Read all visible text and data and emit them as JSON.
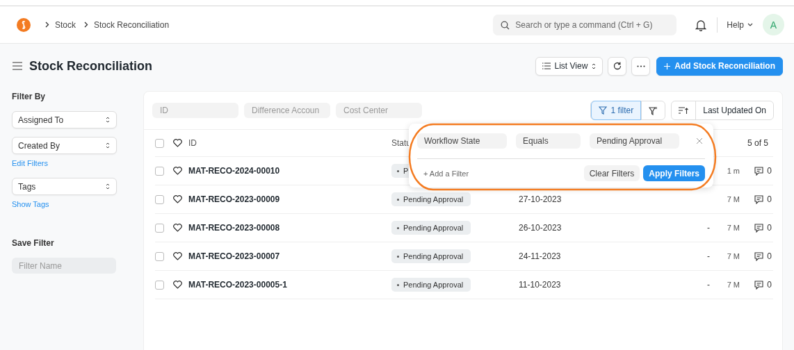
{
  "navbar": {
    "breadcrumbs": [
      "Stock",
      "Stock Reconciliation"
    ],
    "search": {
      "placeholder": "Search or type a command (Ctrl + G)"
    },
    "help": "Help",
    "avatar": "A"
  },
  "page": {
    "title": "Stock Reconciliation",
    "view_button": "List View",
    "add_button": "Add Stock Reconciliation"
  },
  "sidebar": {
    "heading": "Filter By",
    "items": [
      {
        "kind": "select",
        "label": "Assigned To"
      },
      {
        "kind": "select",
        "label": "Created By"
      },
      {
        "kind": "link",
        "label": "Edit Filters"
      },
      {
        "kind": "select",
        "label": "Tags"
      },
      {
        "kind": "link",
        "label": "Show Tags"
      }
    ],
    "save_heading": "Save Filter",
    "filter_name": {
      "placeholder": "Filter Name"
    }
  },
  "list": {
    "filter_fields": [
      {
        "placeholder": "ID"
      },
      {
        "placeholder": "Difference Accoun"
      },
      {
        "placeholder": "Cost Center"
      }
    ],
    "filter_button": "1 filter",
    "sort_label": "Last Updated On",
    "all_checked": false,
    "columns": [
      "ID",
      "Statu"
    ],
    "count": "5 of 5",
    "rows": [
      {
        "id": "MAT-RECO-2024-00010",
        "checked": false,
        "status": "P",
        "date": "",
        "dash": "",
        "modified": "1 m",
        "comments": "0"
      },
      {
        "id": "MAT-RECO-2023-00009",
        "checked": false,
        "status": "Pending Approval",
        "date": "27-10-2023",
        "dash": "",
        "modified": "7 M",
        "comments": "0"
      },
      {
        "id": "MAT-RECO-2023-00008",
        "checked": false,
        "status": "Pending Approval",
        "date": "26-10-2023",
        "dash": "-",
        "modified": "7 M",
        "comments": "0"
      },
      {
        "id": "MAT-RECO-2023-00007",
        "checked": false,
        "status": "Pending Approval",
        "date": "24-11-2023",
        "dash": "-",
        "modified": "7 M",
        "comments": "0"
      },
      {
        "id": "MAT-RECO-2023-00005-1",
        "checked": false,
        "status": "Pending Approval",
        "date": "11-10-2023",
        "dash": "-",
        "modified": "7 M",
        "comments": "0"
      }
    ]
  },
  "filter_popover": {
    "filters": [
      {
        "field": "Workflow State",
        "condition": "Equals",
        "value": "Pending Approval"
      }
    ],
    "add_filter": "+ Add a Filter",
    "clear_button": "Clear Filters",
    "apply_button": "Apply Filters"
  }
}
